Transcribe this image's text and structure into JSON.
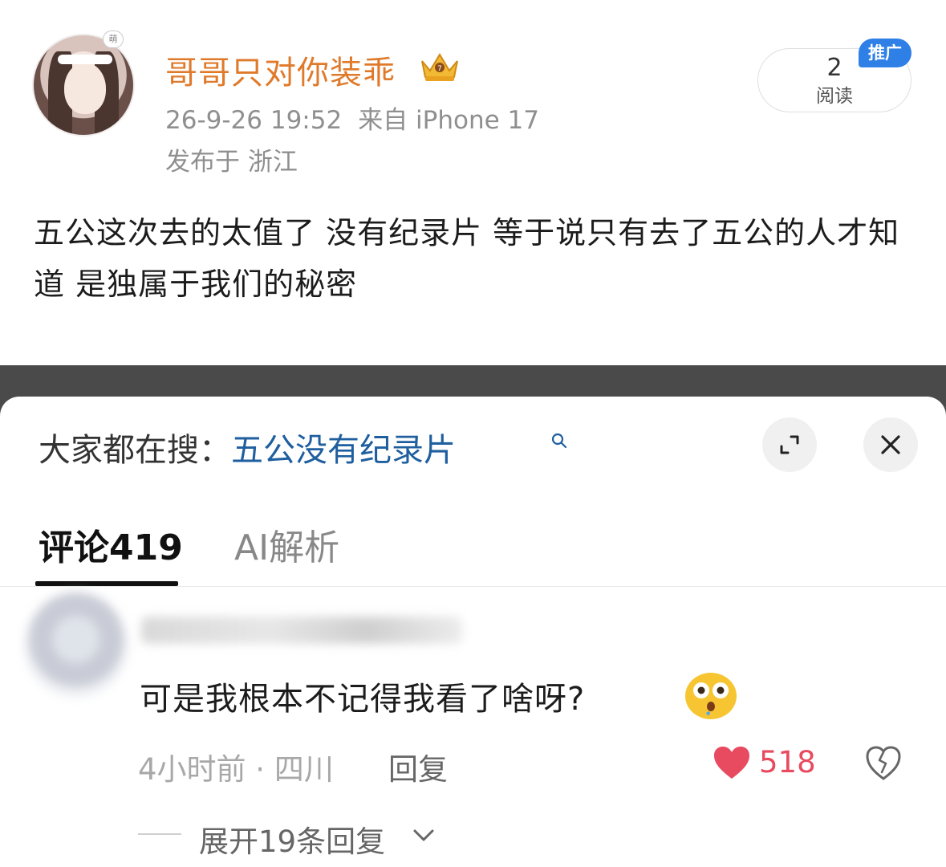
{
  "post": {
    "username": "哥哥只对你装乖",
    "avatar_badge": "萌",
    "timestamp": "26-9-26 19:52",
    "source": "来自 iPhone 17",
    "location": "发布于 浙江",
    "read_count": "2",
    "read_label": "阅读",
    "promo_label": "推广",
    "body": "五公这次去的太值了 没有纪录片 等于说只有去了五公的人才知道 是独属于我们的秘密"
  },
  "search_bar": {
    "prefix": "大家都在搜：",
    "query": "五公没有纪录片"
  },
  "tabs": {
    "comments_label": "评论419",
    "ai_label": "AI解析"
  },
  "comment": {
    "text": "可是我根本不记得我看了啥呀?",
    "meta": "4小时前 · 四川",
    "reply_label": "回复",
    "like_count": "518",
    "expand_replies": "展开19条回复"
  },
  "colors": {
    "username": "#e07a2b",
    "search_query": "#1f5f9f",
    "promo_badge": "#2e7fe6",
    "like": "#e84a5f"
  },
  "icons": [
    "crown-icon",
    "search-icon",
    "expand-icon",
    "close-icon",
    "shocked-emoji-icon",
    "heart-icon",
    "dislike-heart-icon",
    "chevron-down-icon"
  ]
}
